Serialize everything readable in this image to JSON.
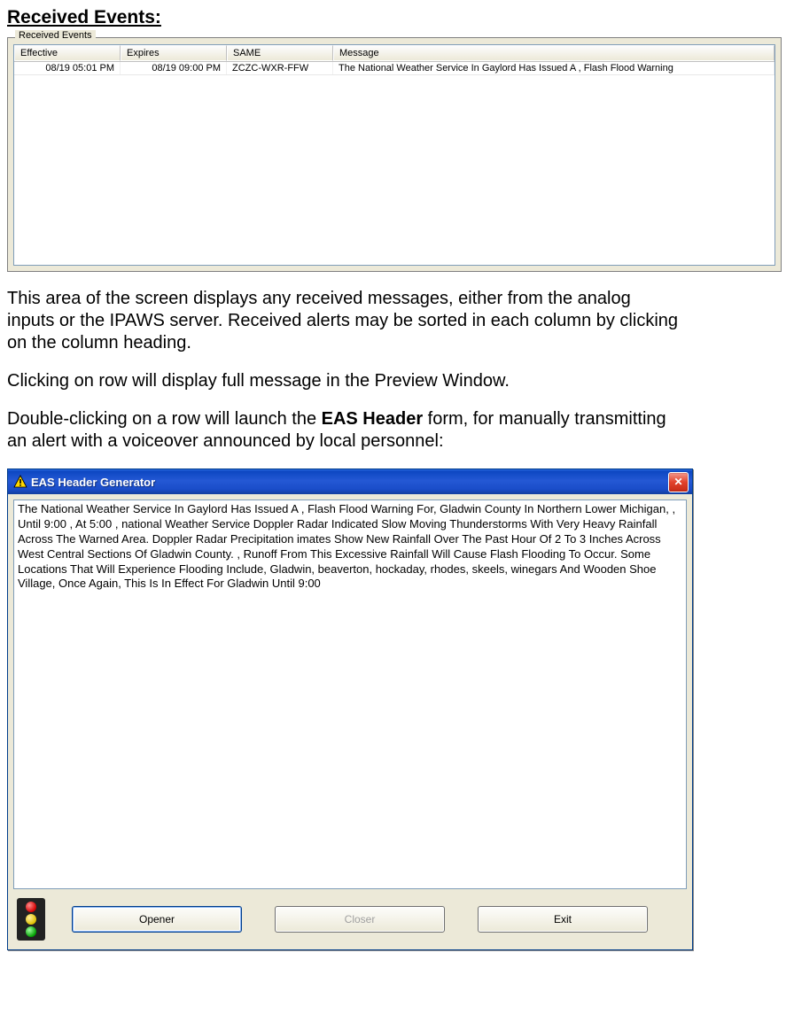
{
  "heading": "Received Events:",
  "groupbox_legend": "Received Events",
  "table": {
    "columns": [
      "Effective",
      "Expires",
      "SAME",
      "Message"
    ],
    "rows": [
      {
        "effective": "08/19 05:01 PM",
        "expires": "08/19 09:00 PM",
        "same": "ZCZC-WXR-FFW",
        "message": "The National Weather Service In Gaylord Has Issued A , Flash Flood Warning"
      }
    ]
  },
  "paragraphs": {
    "p1": "This area of the screen displays any received messages, either from the analog inputs or the IPAWS server.  Received alerts may be sorted in each column by clicking on the column heading.",
    "p2": "Clicking on row will display full message in the Preview Window.",
    "p3_pre": "Double-clicking on a row will launch the ",
    "p3_bold": "EAS Header",
    "p3_post": " form, for manually transmitting an alert with a voiceover announced by local personnel:"
  },
  "dialog": {
    "title": "EAS Header Generator",
    "close_glyph": "✕",
    "message_text": "The National Weather Service In Gaylord Has Issued A , Flash Flood Warning For,  Gladwin County In Northern Lower Michigan,  , Until 9:00  , At 5:00 , national Weather Service Doppler Radar Indicated  Slow Moving Thunderstorms With Very Heavy Rainfall Across The   Warned Area. Doppler Radar Precipitation imates Show New  Rainfall Over The Past Hour Of 2 To 3 Inches Across West Central  Sections Of Gladwin County. , Runoff From This Excessive Rainfall Will Cause Flash Flooding To  Occur. Some Locations That Will Experience Flooding Include,  Gladwin, beaverton, hockaday, rhodes, skeels, winegars And  Wooden Shoe Village,  Once Again, This Is In Effect For Gladwin Until 9:00",
    "buttons": {
      "opener": "Opener",
      "closer": "Closer",
      "exit": "Exit"
    }
  }
}
